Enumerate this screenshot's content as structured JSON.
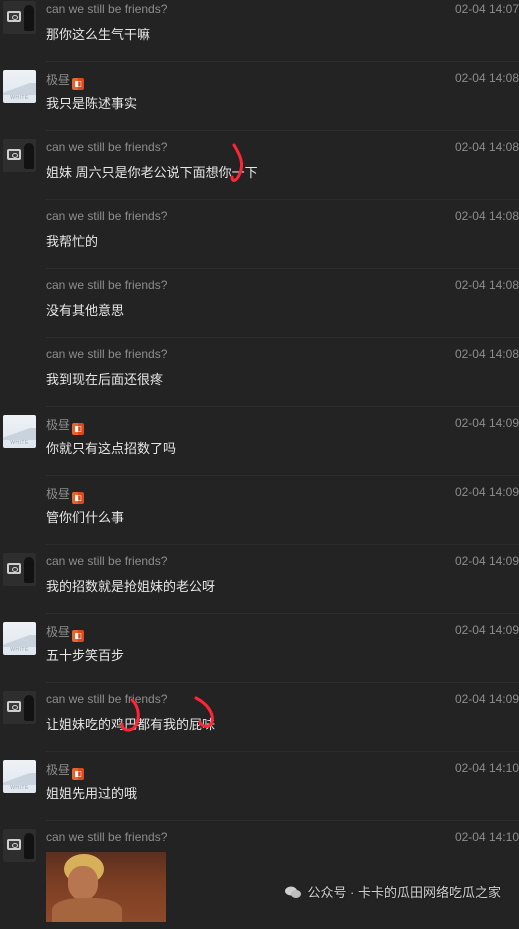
{
  "messages": [
    {
      "sender": "can we still be friends?",
      "time": "02-04 14:07",
      "text": "那你这么生气干嘛",
      "avatar": "dark"
    },
    {
      "sender": "极昼",
      "badge": true,
      "time": "02-04 14:08",
      "text": "我只是陈述事实",
      "avatar": "light"
    },
    {
      "sender": "can we still be friends?",
      "time": "02-04 14:08",
      "text": "姐妹 周六只是你老公说下面想你一下",
      "avatar": "dark"
    },
    {
      "sender": "can we still be friends?",
      "time": "02-04 14:08",
      "text": "我帮忙的",
      "avatar": "none"
    },
    {
      "sender": "can we still be friends?",
      "time": "02-04 14:08",
      "text": "没有其他意思",
      "avatar": "none"
    },
    {
      "sender": "can we still be friends?",
      "time": "02-04 14:08",
      "text": "我到现在后面还很疼",
      "avatar": "none"
    },
    {
      "sender": "极昼",
      "badge": true,
      "time": "02-04 14:09",
      "text": "你就只有这点招数了吗",
      "avatar": "light"
    },
    {
      "sender": "极昼",
      "badge": true,
      "time": "02-04 14:09",
      "text": "管你们什么事",
      "avatar": "none"
    },
    {
      "sender": "can we still be friends?",
      "time": "02-04 14:09",
      "text": "我的招数就是抢姐妹的老公呀",
      "avatar": "dark"
    },
    {
      "sender": "极昼",
      "badge": true,
      "time": "02-04 14:09",
      "text": "五十步笑百步",
      "avatar": "light"
    },
    {
      "sender": "can we still be friends?",
      "time": "02-04 14:09",
      "text": "让姐妹吃的鸡巴都有我的屁味",
      "avatar": "dark"
    },
    {
      "sender": "极昼",
      "badge": true,
      "time": "02-04 14:10",
      "text": "姐姐先用过的哦",
      "avatar": "light"
    },
    {
      "sender": "can we still be friends?",
      "time": "02-04 14:10",
      "text": "",
      "avatar": "dark",
      "image": true
    }
  ],
  "watermark": "公众号 · 卡卡的瓜田网络吃瓜之家"
}
